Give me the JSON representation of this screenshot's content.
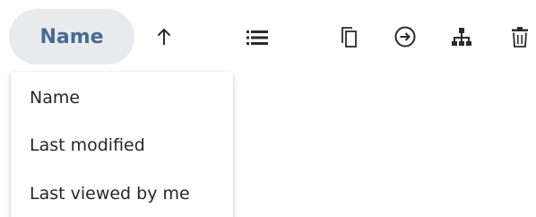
{
  "toolbar": {
    "sort_button_label": "Name",
    "sort_direction_icon": "arrow-up-icon",
    "view_toggle_icon": "list-view-icon",
    "copy_icon": "copy-icon",
    "move_icon": "move-to-icon",
    "hierarchy_icon": "hierarchy-icon",
    "delete_icon": "trash-icon",
    "accent_color": "#4a6b8f",
    "pill_background": "#e8eaed"
  },
  "sort_menu": {
    "items": [
      {
        "label": "Name"
      },
      {
        "label": "Last modified"
      },
      {
        "label": "Last viewed by me"
      }
    ]
  }
}
